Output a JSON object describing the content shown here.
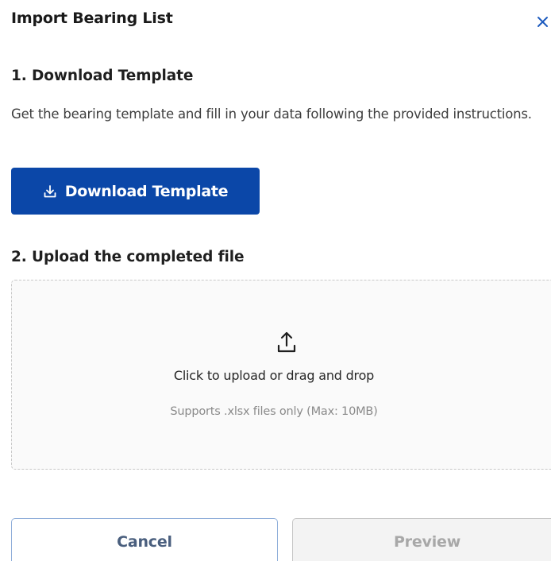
{
  "dialog": {
    "title": "Import Bearing List",
    "close_icon": "close-icon",
    "accent_color": "#0b47a8"
  },
  "step1": {
    "heading": "1. Download Template",
    "description": "Get the bearing template and fill in your data following the provided instructions.",
    "button_label": "Download Template",
    "button_icon": "download-icon"
  },
  "step2": {
    "heading": "2. Upload the completed file",
    "upload_icon": "upload-icon",
    "upload_text": "Click to upload or drag and drop",
    "upload_hint": "Supports .xlsx files only (Max: 10MB)"
  },
  "footer": {
    "cancel_label": "Cancel",
    "preview_label": "Preview",
    "preview_disabled": true
  }
}
